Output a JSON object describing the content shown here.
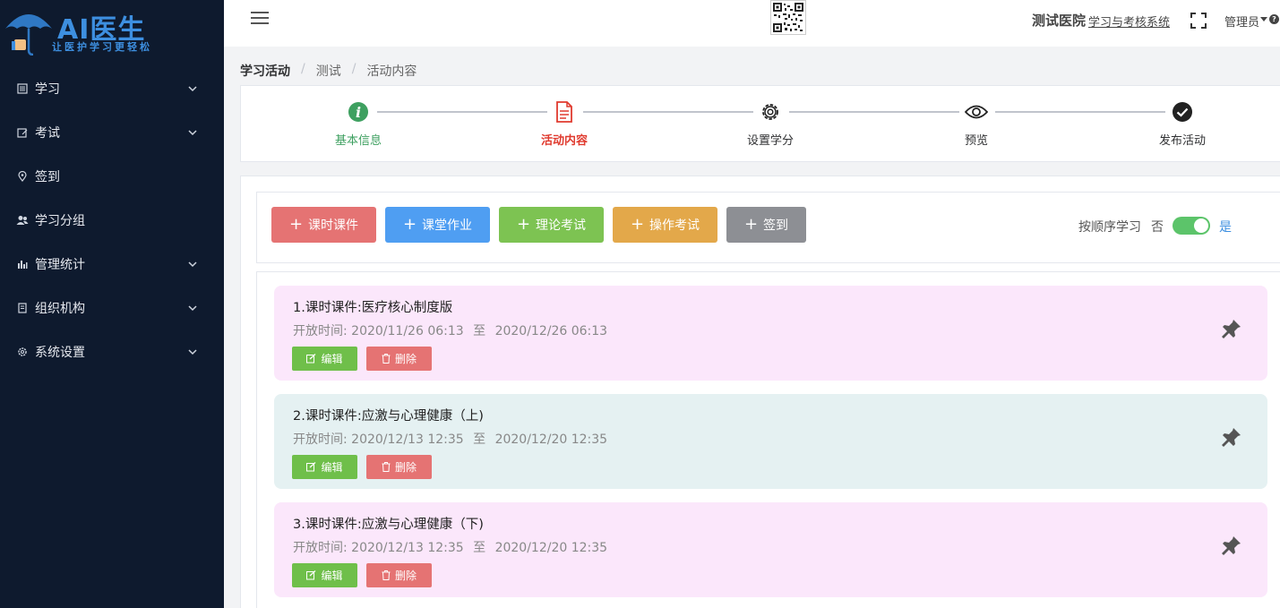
{
  "brand": {
    "title": "AI医生",
    "subtitle": "让医护学习更轻松"
  },
  "sidebar": {
    "items": [
      {
        "label": "学习",
        "icon": "book-icon",
        "expandable": true
      },
      {
        "label": "考试",
        "icon": "exam-icon",
        "expandable": true
      },
      {
        "label": "签到",
        "icon": "location-pin-icon",
        "expandable": false
      },
      {
        "label": "学习分组",
        "icon": "users-icon",
        "expandable": false
      },
      {
        "label": "管理统计",
        "icon": "bar-chart-icon",
        "expandable": true
      },
      {
        "label": "组织机构",
        "icon": "building-icon",
        "expandable": true
      },
      {
        "label": "系统设置",
        "icon": "gear-icon",
        "expandable": true
      }
    ]
  },
  "header": {
    "hospital": "测试医院",
    "system_link": "学习与考核系统",
    "user": "管理员",
    "help": "?"
  },
  "breadcrumb": [
    "学习活动",
    "测试",
    "活动内容"
  ],
  "steps": [
    {
      "label": "基本信息",
      "status": "done",
      "icon": "info-icon"
    },
    {
      "label": "活动内容",
      "status": "active",
      "icon": "document-icon"
    },
    {
      "label": "设置学分",
      "status": "pending",
      "icon": "gear-icon"
    },
    {
      "label": "预览",
      "status": "pending",
      "icon": "eye-icon"
    },
    {
      "label": "发布活动",
      "status": "pending",
      "icon": "check-circle-icon"
    }
  ],
  "toolbar": {
    "buttons": [
      {
        "label": "课时课件",
        "color": "#e57373"
      },
      {
        "label": "课堂作业",
        "color": "#4f9ef2"
      },
      {
        "label": "理论考试",
        "color": "#7dc352"
      },
      {
        "label": "操作考试",
        "color": "#e3a84a"
      },
      {
        "label": "签到",
        "color": "#8d8f94"
      }
    ],
    "order_label": "按顺序学习",
    "order_no": "否",
    "order_yes": "是",
    "order_enabled": true
  },
  "items": [
    {
      "title": "1.课时课件:医疗核心制度版",
      "time_prefix": "开放时间:",
      "start": "2020/11/26 06:13",
      "to": "至",
      "end": "2020/12/26 06:13",
      "edit": "编辑",
      "delete": "删除"
    },
    {
      "title": "2.课时课件:应激与心理健康（上)",
      "time_prefix": "开放时间:",
      "start": "2020/12/13 12:35",
      "to": "至",
      "end": "2020/12/20 12:35",
      "edit": "编辑",
      "delete": "删除"
    },
    {
      "title": "3.课时课件:应激与心理健康（下)",
      "time_prefix": "开放时间:",
      "start": "2020/12/13 12:35",
      "to": "至",
      "end": "2020/12/20 12:35",
      "edit": "编辑",
      "delete": "删除"
    }
  ]
}
